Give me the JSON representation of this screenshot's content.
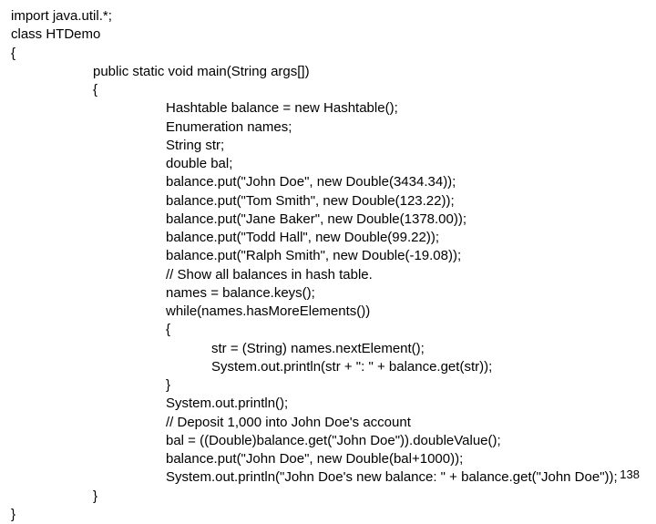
{
  "code": {
    "l01": "import java.util.*;",
    "l02": "class HTDemo",
    "l03": "{",
    "l04": "public static void main(String args[])",
    "l05": "{",
    "l06": "Hashtable balance = new Hashtable();",
    "l07": "Enumeration names;",
    "l08": "String str;",
    "l09": "double bal;",
    "l10": "balance.put(\"John Doe\", new Double(3434.34));",
    "l11": "balance.put(\"Tom Smith\", new Double(123.22));",
    "l12": "balance.put(\"Jane Baker\", new Double(1378.00));",
    "l13": "balance.put(\"Todd Hall\", new Double(99.22));",
    "l14": "balance.put(\"Ralph Smith\", new Double(-19.08));",
    "l15": "// Show all balances in hash table.",
    "l16": "names = balance.keys();",
    "l17": "while(names.hasMoreElements())",
    "l18": "{",
    "l19": "str = (String) names.nextElement();",
    "l20": "System.out.println(str + \": \" + balance.get(str));",
    "l21": "}",
    "l22": "System.out.println();",
    "l23": "// Deposit 1,000 into John Doe's account",
    "l24": "bal = ((Double)balance.get(\"John Doe\")).doubleValue();",
    "l25": "balance.put(\"John Doe\", new Double(bal+1000));",
    "l26": "System.out.println(\"John Doe's new balance: \" + balance.get(\"John Doe\"));",
    "l27": "}",
    "l28": "}"
  },
  "page_number": "138"
}
